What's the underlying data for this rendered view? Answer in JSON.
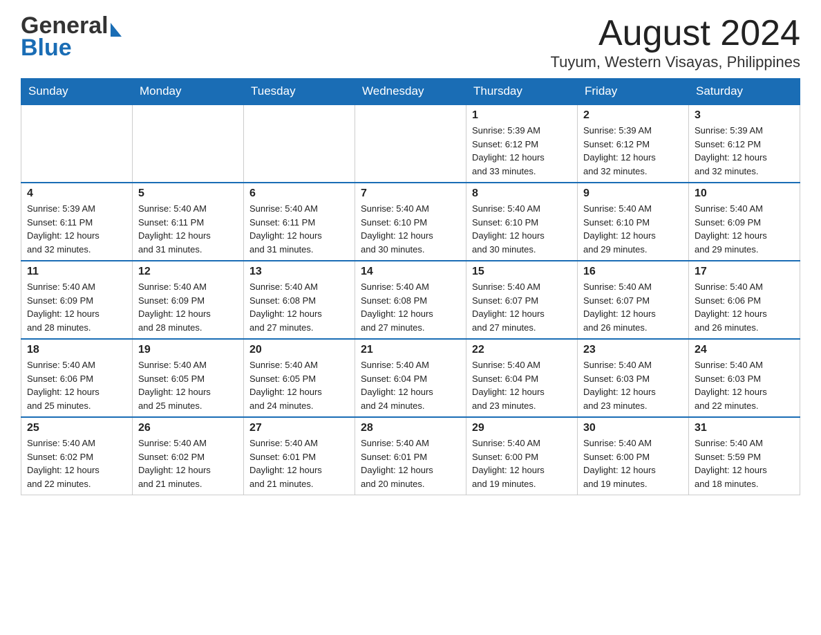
{
  "header": {
    "logo_general": "General",
    "logo_blue": "Blue",
    "month_title": "August 2024",
    "location": "Tuyum, Western Visayas, Philippines"
  },
  "weekdays": [
    "Sunday",
    "Monday",
    "Tuesday",
    "Wednesday",
    "Thursday",
    "Friday",
    "Saturday"
  ],
  "weeks": [
    [
      {
        "day": "",
        "info": ""
      },
      {
        "day": "",
        "info": ""
      },
      {
        "day": "",
        "info": ""
      },
      {
        "day": "",
        "info": ""
      },
      {
        "day": "1",
        "info": "Sunrise: 5:39 AM\nSunset: 6:12 PM\nDaylight: 12 hours\nand 33 minutes."
      },
      {
        "day": "2",
        "info": "Sunrise: 5:39 AM\nSunset: 6:12 PM\nDaylight: 12 hours\nand 32 minutes."
      },
      {
        "day": "3",
        "info": "Sunrise: 5:39 AM\nSunset: 6:12 PM\nDaylight: 12 hours\nand 32 minutes."
      }
    ],
    [
      {
        "day": "4",
        "info": "Sunrise: 5:39 AM\nSunset: 6:11 PM\nDaylight: 12 hours\nand 32 minutes."
      },
      {
        "day": "5",
        "info": "Sunrise: 5:40 AM\nSunset: 6:11 PM\nDaylight: 12 hours\nand 31 minutes."
      },
      {
        "day": "6",
        "info": "Sunrise: 5:40 AM\nSunset: 6:11 PM\nDaylight: 12 hours\nand 31 minutes."
      },
      {
        "day": "7",
        "info": "Sunrise: 5:40 AM\nSunset: 6:10 PM\nDaylight: 12 hours\nand 30 minutes."
      },
      {
        "day": "8",
        "info": "Sunrise: 5:40 AM\nSunset: 6:10 PM\nDaylight: 12 hours\nand 30 minutes."
      },
      {
        "day": "9",
        "info": "Sunrise: 5:40 AM\nSunset: 6:10 PM\nDaylight: 12 hours\nand 29 minutes."
      },
      {
        "day": "10",
        "info": "Sunrise: 5:40 AM\nSunset: 6:09 PM\nDaylight: 12 hours\nand 29 minutes."
      }
    ],
    [
      {
        "day": "11",
        "info": "Sunrise: 5:40 AM\nSunset: 6:09 PM\nDaylight: 12 hours\nand 28 minutes."
      },
      {
        "day": "12",
        "info": "Sunrise: 5:40 AM\nSunset: 6:09 PM\nDaylight: 12 hours\nand 28 minutes."
      },
      {
        "day": "13",
        "info": "Sunrise: 5:40 AM\nSunset: 6:08 PM\nDaylight: 12 hours\nand 27 minutes."
      },
      {
        "day": "14",
        "info": "Sunrise: 5:40 AM\nSunset: 6:08 PM\nDaylight: 12 hours\nand 27 minutes."
      },
      {
        "day": "15",
        "info": "Sunrise: 5:40 AM\nSunset: 6:07 PM\nDaylight: 12 hours\nand 27 minutes."
      },
      {
        "day": "16",
        "info": "Sunrise: 5:40 AM\nSunset: 6:07 PM\nDaylight: 12 hours\nand 26 minutes."
      },
      {
        "day": "17",
        "info": "Sunrise: 5:40 AM\nSunset: 6:06 PM\nDaylight: 12 hours\nand 26 minutes."
      }
    ],
    [
      {
        "day": "18",
        "info": "Sunrise: 5:40 AM\nSunset: 6:06 PM\nDaylight: 12 hours\nand 25 minutes."
      },
      {
        "day": "19",
        "info": "Sunrise: 5:40 AM\nSunset: 6:05 PM\nDaylight: 12 hours\nand 25 minutes."
      },
      {
        "day": "20",
        "info": "Sunrise: 5:40 AM\nSunset: 6:05 PM\nDaylight: 12 hours\nand 24 minutes."
      },
      {
        "day": "21",
        "info": "Sunrise: 5:40 AM\nSunset: 6:04 PM\nDaylight: 12 hours\nand 24 minutes."
      },
      {
        "day": "22",
        "info": "Sunrise: 5:40 AM\nSunset: 6:04 PM\nDaylight: 12 hours\nand 23 minutes."
      },
      {
        "day": "23",
        "info": "Sunrise: 5:40 AM\nSunset: 6:03 PM\nDaylight: 12 hours\nand 23 minutes."
      },
      {
        "day": "24",
        "info": "Sunrise: 5:40 AM\nSunset: 6:03 PM\nDaylight: 12 hours\nand 22 minutes."
      }
    ],
    [
      {
        "day": "25",
        "info": "Sunrise: 5:40 AM\nSunset: 6:02 PM\nDaylight: 12 hours\nand 22 minutes."
      },
      {
        "day": "26",
        "info": "Sunrise: 5:40 AM\nSunset: 6:02 PM\nDaylight: 12 hours\nand 21 minutes."
      },
      {
        "day": "27",
        "info": "Sunrise: 5:40 AM\nSunset: 6:01 PM\nDaylight: 12 hours\nand 21 minutes."
      },
      {
        "day": "28",
        "info": "Sunrise: 5:40 AM\nSunset: 6:01 PM\nDaylight: 12 hours\nand 20 minutes."
      },
      {
        "day": "29",
        "info": "Sunrise: 5:40 AM\nSunset: 6:00 PM\nDaylight: 12 hours\nand 19 minutes."
      },
      {
        "day": "30",
        "info": "Sunrise: 5:40 AM\nSunset: 6:00 PM\nDaylight: 12 hours\nand 19 minutes."
      },
      {
        "day": "31",
        "info": "Sunrise: 5:40 AM\nSunset: 5:59 PM\nDaylight: 12 hours\nand 18 minutes."
      }
    ]
  ]
}
